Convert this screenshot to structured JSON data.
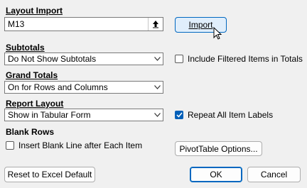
{
  "layout_import": {
    "label": "Layout Import",
    "value": "M13",
    "button": "Import"
  },
  "subtotals": {
    "label": "Subtotals",
    "selected": "Do Not Show Subtotals"
  },
  "include_filtered": {
    "label": "Include Filtered Items in Totals",
    "checked": false
  },
  "grand_totals": {
    "label": "Grand Totals",
    "selected": "On for Rows and Columns"
  },
  "report_layout": {
    "label": "Report Layout",
    "selected": "Show in Tabular Form"
  },
  "repeat_labels": {
    "label": "Repeat All Item Labels",
    "checked": true
  },
  "blank_rows": {
    "label": "Blank Rows",
    "insert_label": "Insert Blank Line after Each Item",
    "checked": false
  },
  "pivot_options_button": "PivotTable Options...",
  "reset_button": "Reset to Excel Default",
  "ok_button": "OK",
  "cancel_button": "Cancel",
  "colors": {
    "accent": "#005fb8",
    "dialog_bg": "#f0f0f0"
  }
}
